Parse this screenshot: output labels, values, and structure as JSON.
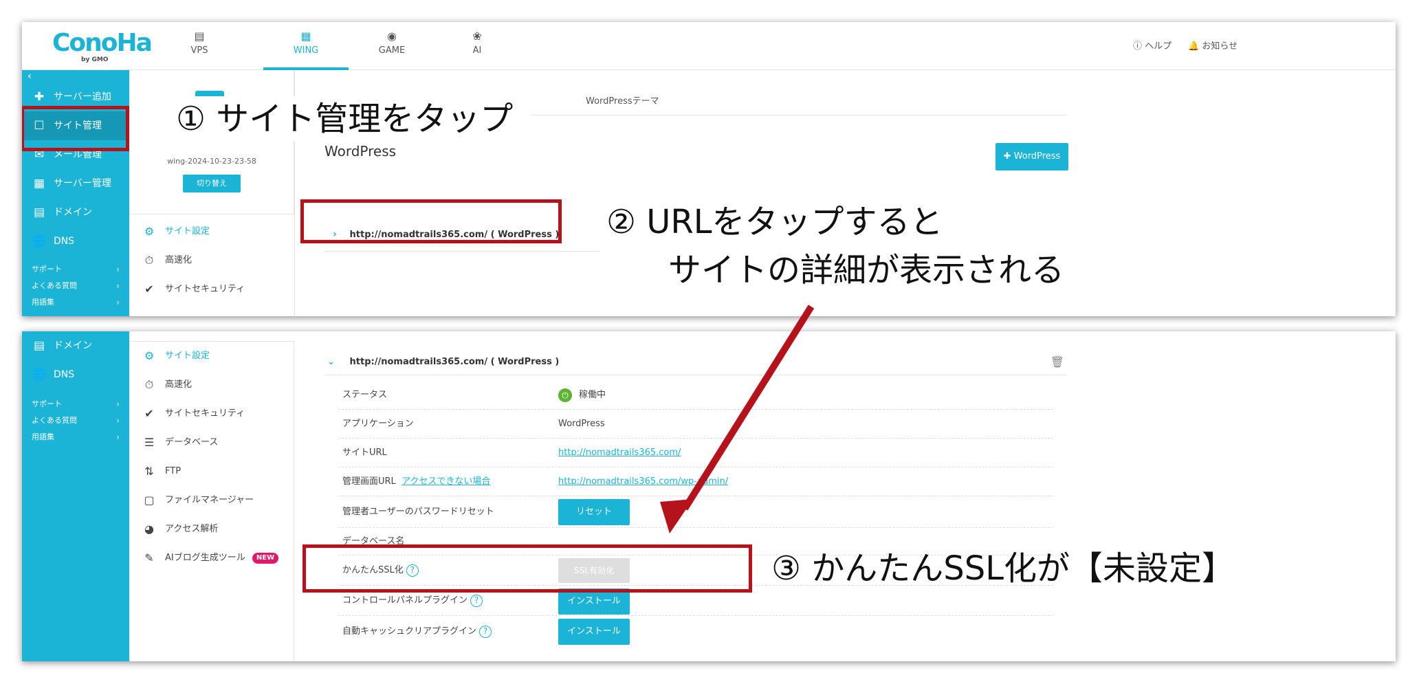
{
  "header": {
    "logo": "ConoHa",
    "logo_sub": "by GMO",
    "tabs": [
      {
        "label": "VPS",
        "icon": "server-icon"
      },
      {
        "label": "WING",
        "icon": "wing-icon"
      },
      {
        "label": "GAME",
        "icon": "gamepad-icon"
      },
      {
        "label": "AI",
        "icon": "ai-brain-icon"
      }
    ],
    "help": "ヘルプ",
    "notice": "お知らせ"
  },
  "sidebar": {
    "items": [
      {
        "label": "サーバー追加",
        "icon": "plus-icon"
      },
      {
        "label": "サイト管理",
        "icon": "site-icon"
      },
      {
        "label": "メール管理",
        "icon": "mail-icon"
      },
      {
        "label": "サーバー管理",
        "icon": "server-manage-icon"
      },
      {
        "label": "ドメイン",
        "icon": "domain-icon"
      },
      {
        "label": "DNS",
        "icon": "globe-icon"
      }
    ],
    "sub": [
      {
        "label": "サポート"
      },
      {
        "label": "よくある質問"
      },
      {
        "label": "用語集"
      }
    ]
  },
  "server": {
    "id": "wing-2024-10-23-23-58",
    "switch": "切り替え"
  },
  "subnav": [
    {
      "label": "サイト設定",
      "icon": "site-settings-icon"
    },
    {
      "label": "高速化",
      "icon": "stopwatch-icon"
    },
    {
      "label": "サイトセキュリティ",
      "icon": "shield-icon"
    },
    {
      "label": "データベース",
      "icon": "database-icon"
    },
    {
      "label": "FTP",
      "icon": "ftp-icon"
    },
    {
      "label": "ファイルマネージャー",
      "icon": "folder-icon"
    },
    {
      "label": "アクセス解析",
      "icon": "pie-chart-icon"
    },
    {
      "label": "AIブログ生成ツール",
      "icon": "ai-blog-icon",
      "badge": "NEW"
    }
  ],
  "main": {
    "tabs": [
      "WordPressテーマ"
    ],
    "wp_title": "WordPress",
    "add_button": "WordPress",
    "site_url_row": "http://nomadtrails365.com/ ( WordPress )"
  },
  "details": {
    "rows": [
      {
        "label": "ステータス",
        "value": "稼働中"
      },
      {
        "label": "アプリケーション",
        "value": "WordPress"
      },
      {
        "label": "サイトURL",
        "value": "http://nomadtrails365.com/"
      },
      {
        "label": "管理画面URL",
        "label_link": "アクセスできない場合",
        "value": "http://nomadtrails365.com/wp-admin/"
      },
      {
        "label": "管理者ユーザーのパスワードリセット",
        "button": "リセット"
      },
      {
        "label": "データベース名"
      },
      {
        "label": "かんたんSSL化",
        "button": "SSL有効化"
      },
      {
        "label": "コントロールパネルプラグイン",
        "button": "インストール"
      },
      {
        "label": "自動キャッシュクリアプラグイン",
        "button": "インストール"
      }
    ]
  },
  "annotations": {
    "step1": "① サイト管理をタップ",
    "step2_line1": "② URLをタップすると",
    "step2_line2": "サイトの詳細が表示される",
    "step3": "③ かんたんSSL化が【未設定】"
  },
  "colors": {
    "accent": "#1bb4d6",
    "annotation_red": "#b5121b",
    "badge_new": "#e0186b",
    "status_green": "#5cb531"
  }
}
